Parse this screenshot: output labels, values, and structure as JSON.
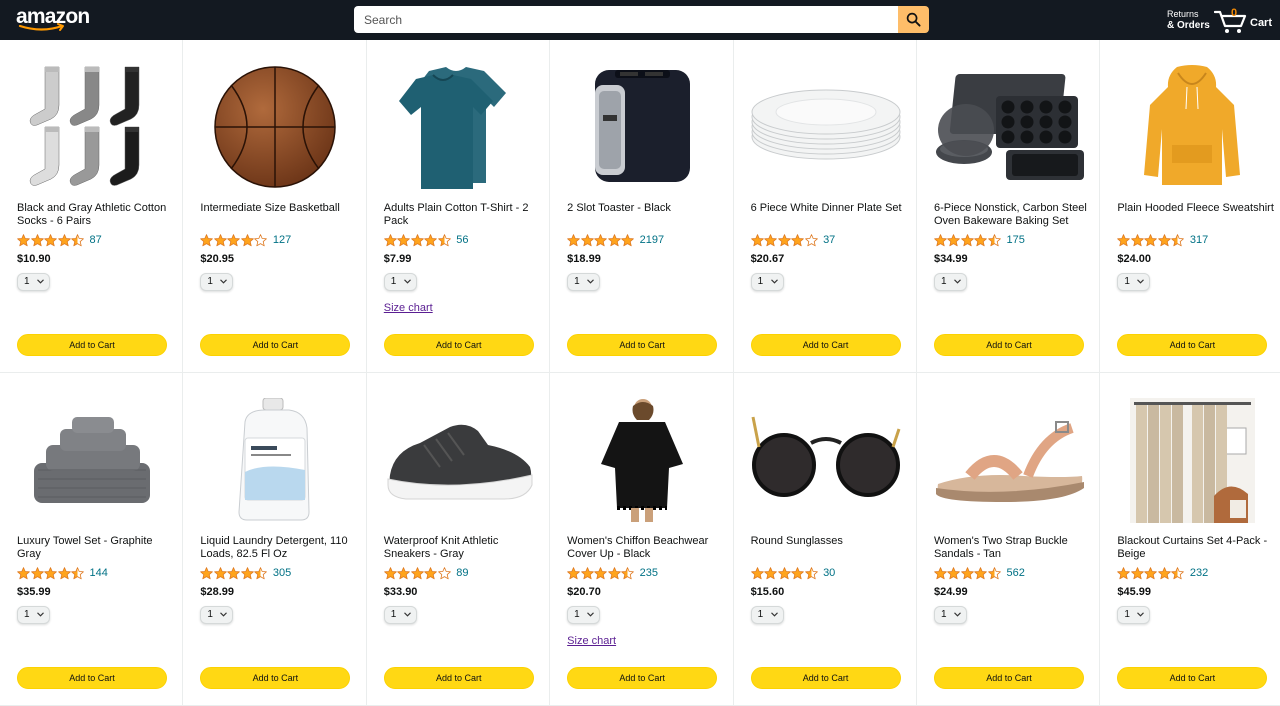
{
  "header": {
    "logo_text": "amazon",
    "search_placeholder": "Search",
    "returns_line1": "Returns",
    "returns_line2": "& Orders",
    "cart_count": "0",
    "cart_label": "Cart"
  },
  "colors": {
    "header_bg": "#131921",
    "search_button": "#febd69",
    "add_to_cart": "#ffd814",
    "star": "#ffa41c",
    "link": "#007185",
    "cart_count": "#f08804"
  },
  "common": {
    "add_to_cart_label": "Add to Cart",
    "size_chart_label": "Size chart"
  },
  "products": [
    {
      "title": "Black and Gray Athletic Cotton Socks - 6 Pairs",
      "stars": 4.5,
      "reviews": "87",
      "price": "$10.90",
      "qty": "1",
      "image": "socks-image"
    },
    {
      "title": "Intermediate Size Basketball",
      "stars": 4.0,
      "reviews": "127",
      "price": "$20.95",
      "qty": "1",
      "image": "basketball-image"
    },
    {
      "title": "Adults Plain Cotton T-Shirt - 2 Pack",
      "stars": 4.5,
      "reviews": "56",
      "price": "$7.99",
      "qty": "1",
      "image": "tshirt-image",
      "size_chart": true
    },
    {
      "title": "2 Slot Toaster - Black",
      "stars": 5.0,
      "reviews": "2197",
      "price": "$18.99",
      "qty": "1",
      "image": "toaster-image"
    },
    {
      "title": "6 Piece White Dinner Plate Set",
      "stars": 4.0,
      "reviews": "37",
      "price": "$20.67",
      "qty": "1",
      "image": "plates-image"
    },
    {
      "title": "6-Piece Nonstick, Carbon Steel Oven Bakeware Baking Set",
      "stars": 4.5,
      "reviews": "175",
      "price": "$34.99",
      "qty": "1",
      "image": "bakeware-image"
    },
    {
      "title": "Plain Hooded Fleece Sweatshirt",
      "stars": 4.5,
      "reviews": "317",
      "price": "$24.00",
      "qty": "1",
      "image": "hoodie-image"
    },
    {
      "title": "Luxury Towel Set - Graphite Gray",
      "stars": 4.5,
      "reviews": "144",
      "price": "$35.99",
      "qty": "1",
      "image": "towels-image"
    },
    {
      "title": "Liquid Laundry Detergent, 110 Loads, 82.5 Fl Oz",
      "stars": 4.5,
      "reviews": "305",
      "price": "$28.99",
      "qty": "1",
      "image": "detergent-image"
    },
    {
      "title": "Waterproof Knit Athletic Sneakers - Gray",
      "stars": 4.0,
      "reviews": "89",
      "price": "$33.90",
      "qty": "1",
      "image": "sneakers-image"
    },
    {
      "title": "Women's Chiffon Beachwear Cover Up - Black",
      "stars": 4.5,
      "reviews": "235",
      "price": "$20.70",
      "qty": "1",
      "image": "coverup-image",
      "size_chart": true
    },
    {
      "title": "Round Sunglasses",
      "stars": 4.5,
      "reviews": "30",
      "price": "$15.60",
      "qty": "1",
      "image": "sunglasses-image"
    },
    {
      "title": "Women's Two Strap Buckle Sandals - Tan",
      "stars": 4.5,
      "reviews": "562",
      "price": "$24.99",
      "qty": "1",
      "image": "sandals-image"
    },
    {
      "title": "Blackout Curtains Set 4-Pack - Beige",
      "stars": 4.5,
      "reviews": "232",
      "price": "$45.99",
      "qty": "1",
      "image": "curtains-image"
    }
  ]
}
